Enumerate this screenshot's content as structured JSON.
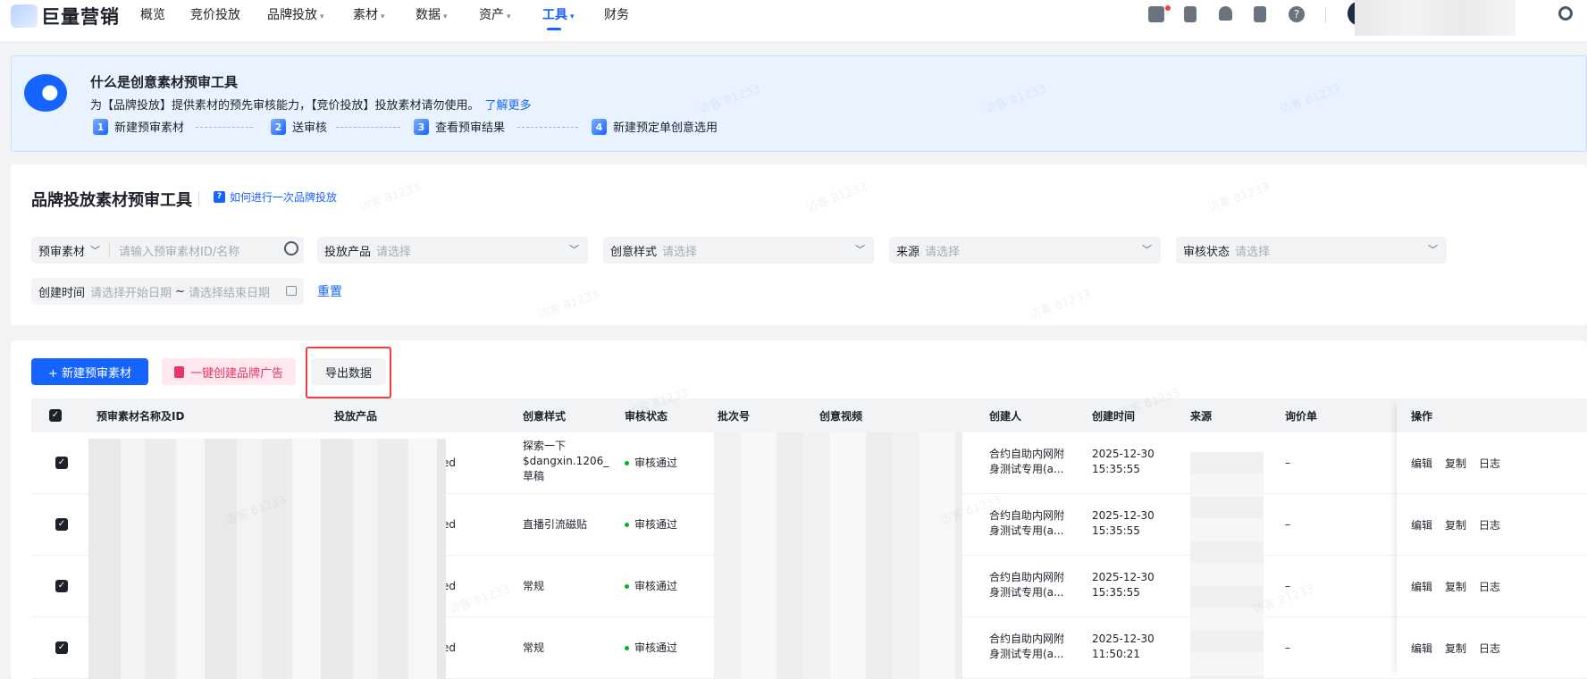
{
  "nav": {
    "logo_text": "巨量营销",
    "items": [
      {
        "label": "概览",
        "caret": ""
      },
      {
        "label": "竞价投放",
        "caret": ""
      },
      {
        "label": "品牌投放",
        "caret": "▾"
      },
      {
        "label": "素材",
        "caret": "▾"
      },
      {
        "label": "数据",
        "caret": "▾"
      },
      {
        "label": "资产",
        "caret": "▾"
      },
      {
        "label": "工具",
        "caret": "▾"
      },
      {
        "label": "财务",
        "caret": ""
      }
    ],
    "active": "工具",
    "icons": [
      "gift-icon",
      "clipboard-icon",
      "bell-icon",
      "book-icon",
      "help-icon",
      "settings-icon"
    ],
    "help_glyph": "?"
  },
  "banner": {
    "title": "什么是创意素材预审工具",
    "desc": "为【品牌投放】提供素材的预先审核能力，【竞价投放】投放素材请勿使用。",
    "link": "了解更多",
    "steps": [
      {
        "num": "1",
        "label": "新建预审素材"
      },
      {
        "num": "2",
        "label": "送审核"
      },
      {
        "num": "3",
        "label": "查看预审结果"
      },
      {
        "num": "4",
        "label": "新建预定单创意选用"
      }
    ]
  },
  "filters": {
    "page_title": "品牌投放素材预审工具",
    "how_icon": "?",
    "how_link": "如何进行一次品牌投放",
    "material_select": "预审素材",
    "material_placeholder": "请输入预审素材ID/名称",
    "product_label": "投放产品",
    "product_placeholder": "请选择",
    "style_label": "创意样式",
    "style_placeholder": "请选择",
    "source_label": "来源",
    "source_placeholder": "请选择",
    "review_label": "审核状态",
    "review_placeholder": "请选择",
    "created_label": "创建时间",
    "start_placeholder": "请选择开始日期",
    "range_sep": "~",
    "end_placeholder": "请选择结束日期",
    "reset": "重置"
  },
  "toolbar": {
    "new_material": "+ 新建预审素材",
    "one_click_create": "一键创建品牌广告",
    "export": "导出数据"
  },
  "table": {
    "columns": [
      "预审素材名称及ID",
      "投放产品",
      "创意样式",
      "审核状态",
      "批次号",
      "创意视频",
      "创建人",
      "创建时间",
      "来源",
      "询价单",
      "操作"
    ],
    "rows": [
      {
        "product_suffix": "ed",
        "style": "探索一下\n$dangxin.1206_\n草稿",
        "status": "审核通过",
        "creator": "合约自助内网附\n身测试专用(a...",
        "created": "2025-12-30\n15:35:55",
        "inquiry": "–"
      },
      {
        "product_suffix": "ed",
        "style": "直播引流磁贴",
        "status": "审核通过",
        "creator": "合约自助内网附\n身测试专用(a...",
        "created": "2025-12-30\n15:35:55",
        "inquiry": "–"
      },
      {
        "product_suffix": "ed",
        "style": "常规",
        "status": "审核通过",
        "creator": "合约自助内网附\n身测试专用(a...",
        "created": "2025-12-30\n15:35:55",
        "inquiry": "–"
      },
      {
        "product_suffix": "ed",
        "style": "常规",
        "status": "审核通过",
        "creator": "合约自助内网附\n身测试专用(a...",
        "created": "2025-12-30\n11:50:21",
        "inquiry": "–"
      }
    ],
    "actions": [
      "编辑",
      "复制",
      "日志"
    ],
    "check_glyph": "✓"
  },
  "watermark": "访客 81233",
  "colors": {
    "accent": "#1664ff",
    "success": "#00b42a",
    "pink": "#e8336b",
    "highlight_frame": "#ef3b3b"
  }
}
